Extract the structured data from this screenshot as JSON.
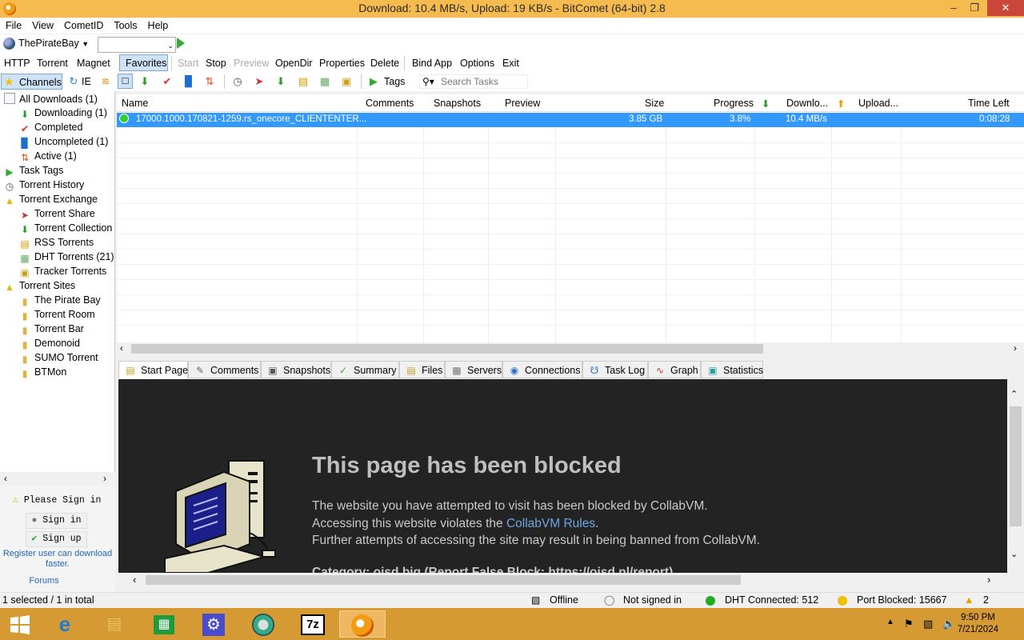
{
  "window": {
    "title": "Download: 10.4 MB/s, Upload: 19 KB/s - BitComet (64-bit) 2.8"
  },
  "menu": [
    "File",
    "View",
    "CometID",
    "Tools",
    "Help"
  ],
  "favorite_selector": {
    "label": "ThePirateBay",
    "combo_value": ""
  },
  "toolbar": {
    "http": "HTTP",
    "torrent": "Torrent",
    "magnet": "Magnet",
    "favorites": "Favorites",
    "start": "Start",
    "stop": "Stop",
    "preview": "Preview",
    "opendir": "OpenDir",
    "properties": "Properties",
    "delete": "Delete",
    "bind_app": "Bind App",
    "options": "Options",
    "exit": "Exit"
  },
  "toolbar2": {
    "channels": "Channels",
    "ie": "IE",
    "tags": "Tags",
    "search_placeholder": "Search Tasks"
  },
  "sidebar": {
    "all_downloads": "All Downloads (1)",
    "downloading": "Downloading (1)",
    "completed": "Completed",
    "uncompleted": "Uncompleted (1)",
    "active": "Active (1)",
    "task_tags": "Task Tags",
    "torrent_history": "Torrent History",
    "torrent_exchange": "Torrent Exchange",
    "torrent_share": "Torrent Share",
    "torrent_collection": "Torrent Collection",
    "rss_torrents": "RSS Torrents",
    "dht_torrents": "DHT Torrents (21)",
    "tracker_torrents": "Tracker Torrents",
    "torrent_sites": "Torrent Sites",
    "pirate_bay": "The Pirate Bay",
    "torrent_room": "Torrent Room",
    "torrent_bar": "Torrent Bar",
    "demonoid": "Demonoid",
    "sumo_torrent": "SUMO Torrent",
    "btmon": "BTMon"
  },
  "signin": {
    "please": "Please Sign in",
    "sign_in": "Sign in",
    "sign_up": "Sign up",
    "register": "Register user can download faster.",
    "forums": "Forums"
  },
  "columns": {
    "name": "Name",
    "comments": "Comments",
    "snapshots": "Snapshots",
    "preview": "Preview",
    "size": "Size",
    "progress": "Progress",
    "download": "Downlo...",
    "upload": "Upload...",
    "time_left": "Time Left"
  },
  "task": {
    "name": "17000.1000.170821-1259.rs_onecore_CLIENTENTER...",
    "size": "3.85 GB",
    "progress": "3.8%",
    "download": "10.4 MB/s",
    "upload": "",
    "time_left": "0:08:28"
  },
  "tabs": [
    "Start Page",
    "Comments",
    "Snapshots",
    "Summary",
    "Files",
    "Servers",
    "Connections",
    "Task Log",
    "Graph",
    "Statistics"
  ],
  "blocked_page": {
    "title": "This page has been blocked",
    "line1": "The website you have attempted to visit has been blocked by CollabVM.",
    "line2_pre": "Accessing this website violates the ",
    "line2_link": "CollabVM Rules",
    "line2_post": ".",
    "line3": "Further attempts of accessing the site may result in being banned from CollabVM.",
    "line4": "Category: oisd big (Report False Block: https://oisd.nl/report)"
  },
  "status": {
    "selection": "1 selected / 1 in total",
    "offline": "Offline",
    "not_signed": "Not signed in",
    "dht": "DHT Connected: 512",
    "port": "Port Blocked: 15667",
    "count": "2"
  },
  "clock": {
    "time": "9:50 PM",
    "date": "7/21/2024"
  }
}
